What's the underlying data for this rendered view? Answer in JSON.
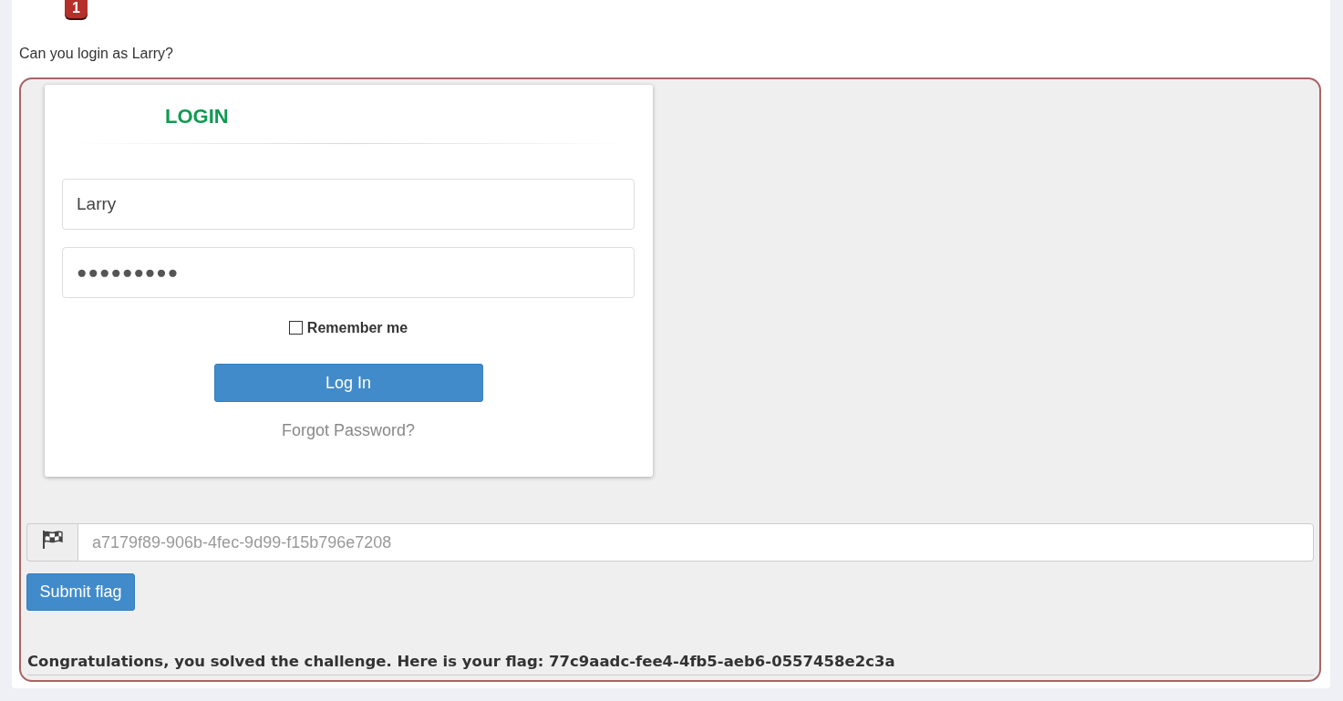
{
  "badge": {
    "text": "1"
  },
  "prompt": "Can you login as Larry?",
  "login_form": {
    "title": "LOGIN",
    "username": {
      "value": "Larry"
    },
    "password": {
      "value": "●●●●●●●●●"
    },
    "remember_me": {
      "label": "Remember me",
      "checked": false
    },
    "login_button": "Log In",
    "forgot_password": "Forgot Password?"
  },
  "flag_form": {
    "placeholder": "a7179f89-906b-4fec-9d99-f15b796e7208",
    "submit_button": "Submit flag"
  },
  "result": "Congratulations, you solved the challenge. Here is your flag: 77c9aadc-fee4-4fb5-aeb6-0557458e2c3a"
}
